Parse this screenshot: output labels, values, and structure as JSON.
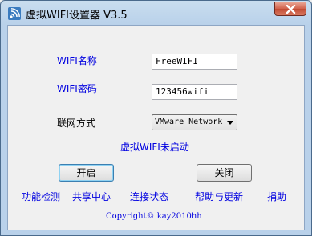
{
  "window": {
    "title": "虚拟WIFI设置器 V3.5"
  },
  "form": {
    "wifi_name_label": "WIFI名称",
    "wifi_name_value": "FreeWIFI",
    "wifi_password_label": "WIFI密码",
    "wifi_password_value": "123456wifi",
    "network_mode_label": "联网方式",
    "network_mode_selected": "VMware Network"
  },
  "status_text": "虚拟WIFI未启动",
  "buttons": {
    "start_label": "开启",
    "close_label": "关闭"
  },
  "links": [
    "功能检测",
    "共享中心",
    "连接状态",
    "帮助与更新",
    "捐助"
  ],
  "copyright": "Copyright© kay2010hh",
  "colors": {
    "link_blue": "#0000e0",
    "title_bar": "#b9d1ea",
    "close_red": "#c24a33"
  },
  "icons": {
    "app": "wifi-signal-icon",
    "close": "close-icon",
    "dropdown": "chevron-down-icon"
  }
}
